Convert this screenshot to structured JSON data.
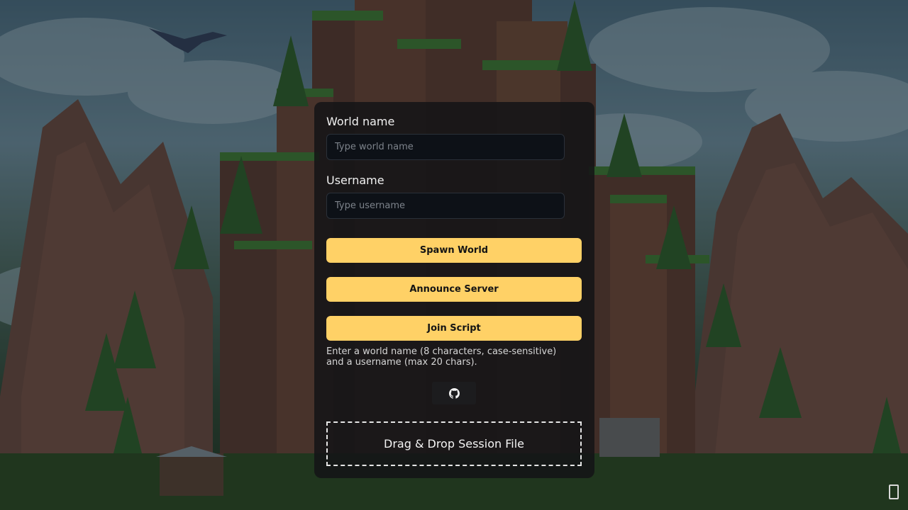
{
  "form": {
    "world_name_label": "World name",
    "world_name_placeholder": "Type world name",
    "world_name_value": "",
    "username_label": "Username",
    "username_placeholder": "Type username",
    "username_value": ""
  },
  "actions": {
    "spawn_label": "Spawn World",
    "announce_label": "Announce Server",
    "join_label": "Join Script"
  },
  "hint": "Enter a world name (8 characters, case-sensitive) and a username (max 20 chars).",
  "github": {
    "icon": "github-icon"
  },
  "dropzone": {
    "label": "Drag & Drop Session File"
  },
  "corner": {
    "icon": "missing-glyph-icon"
  },
  "colors": {
    "accent": "#ffd166",
    "panel_bg": "#141416",
    "input_bg": "#0d1117"
  }
}
